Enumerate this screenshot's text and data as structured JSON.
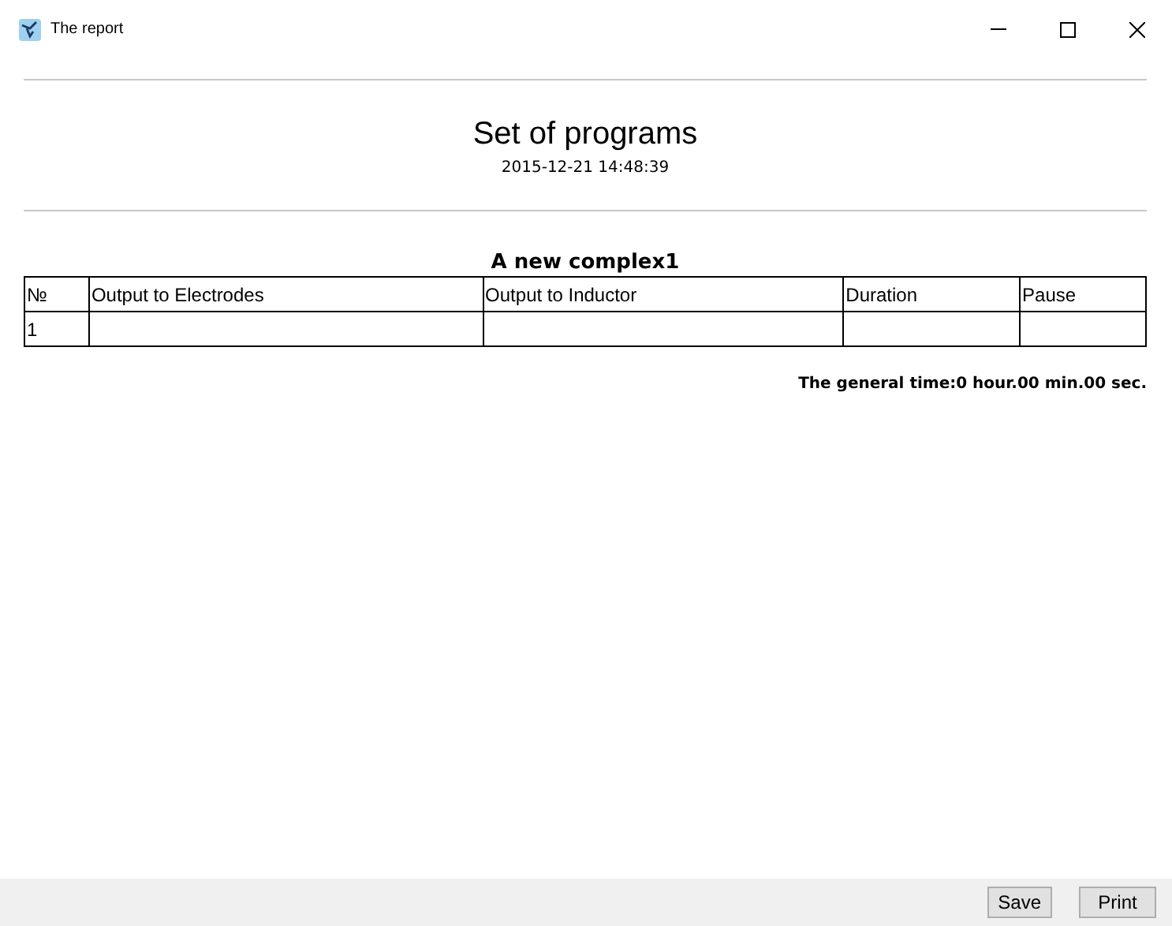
{
  "window": {
    "title": "The report"
  },
  "report": {
    "title": "Set of programs",
    "date": "2015-12-21 14:48:39",
    "caption": "A new complex1",
    "columns": [
      "№",
      "Output to Electrodes",
      "Output to Inductor",
      "Duration",
      "Pause"
    ],
    "rows": [
      [
        "1",
        "",
        "",
        "",
        ""
      ]
    ],
    "total": "The general time:0 hour.00 min.00 sec."
  },
  "buttons": [
    "Save",
    "Print"
  ]
}
